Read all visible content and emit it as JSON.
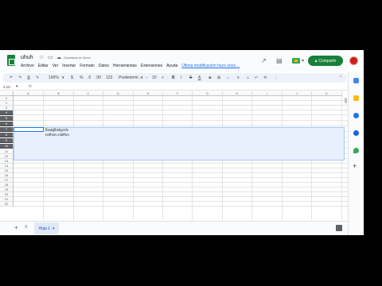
{
  "window": {
    "doc_title": "uhuh",
    "save_status": "Guardado en Drive",
    "menus": [
      "Archivo",
      "Editar",
      "Ver",
      "Insertar",
      "Formato",
      "Datos",
      "Herramientas",
      "Extensiones",
      "Ayuda"
    ],
    "last_edit": "Última modificación hace unos…",
    "share_label": "Compartir"
  },
  "toolbar": {
    "zoom": "100%",
    "currency": "$",
    "percent": "%",
    "decimal_down": ".0",
    "decimal_up": ".00",
    "number_format": "123",
    "font": "Predetermi...",
    "font_size": "10",
    "bold": "B",
    "italic": "I",
    "strike": "S",
    "text_color": "A"
  },
  "formula_bar": {
    "name_box": "4:10",
    "fx": "fx"
  },
  "grid": {
    "columns": [
      "A",
      "B",
      "C",
      "D",
      "E",
      "F",
      "G",
      "H",
      "I",
      "J",
      "K"
    ],
    "rows": [
      "1",
      "2",
      "3",
      "4",
      "5",
      "6",
      "7",
      "8",
      "9",
      "10",
      "11",
      "12",
      "13",
      "14",
      "15",
      "16",
      "17",
      "18",
      "19",
      "20",
      "21",
      "22"
    ],
    "cell_b4_lines": [
      "fbsdgfbsfgcnfv",
      "nnfhvm.rsbfhm"
    ]
  },
  "sheet_tabs": [
    {
      "label": "Hoja 1",
      "active": true
    }
  ],
  "colors": {
    "brand_green": "#188038",
    "selection_fill": "#e8f0fe",
    "selection_border": "#1a73e8",
    "selected_row_header": "#5f6368"
  },
  "icons": {
    "title_bar": [
      "star-icon",
      "move-icon",
      "cloud-icon"
    ],
    "header": [
      "trend-icon",
      "comment-icon",
      "meet-icon",
      "lock-icon"
    ],
    "side_panel": [
      "calendar-icon",
      "keep-icon",
      "tasks-icon",
      "contacts-icon",
      "maps-icon",
      "plus-icon"
    ]
  }
}
